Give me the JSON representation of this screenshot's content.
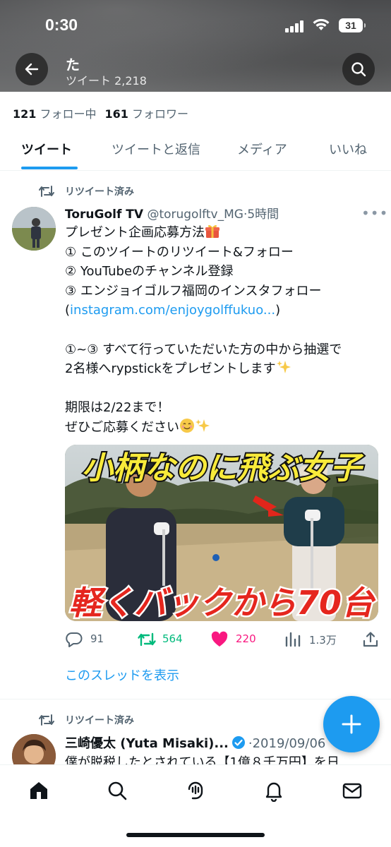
{
  "status_bar": {
    "time": "0:30",
    "battery": "31"
  },
  "header": {
    "title": "た",
    "tweet_count_label": "ツイート 2,218"
  },
  "follow": {
    "following_count": "121",
    "following_label": "フォロー中",
    "followers_count": "161",
    "followers_label": "フォロワー"
  },
  "tabs": [
    {
      "label": "ツイート",
      "active": true
    },
    {
      "label": "ツイートと返信"
    },
    {
      "label": "メディア"
    },
    {
      "label": "いいね"
    }
  ],
  "tweet1": {
    "retweet_label": "リツイート済み",
    "name": "ToruGolf TV",
    "handle": "@torugolftv_MG",
    "separator": "·",
    "time": "5時間",
    "lines": {
      "l1": "プレゼント企画応募方法",
      "l2": "① このツイートのリツイート&フォロー",
      "l3": "② YouTubeのチャンネル登録",
      "l4": "③ エンジョイゴルフ福岡のインスタフォロー",
      "l5_open": "(",
      "l5_link": "instagram.com/enjoygolffukuo...",
      "l5_close": ")",
      "l6": "①~③ すべて行っていただいた方の中から抽選で",
      "l7": "2名様へrypstickをプレゼントします",
      "l8": "期限は2/22まで！",
      "l9": "ぜひご応募ください"
    },
    "media": {
      "top_caption": "小柄なのに飛ぶ女子",
      "bottom_caption": "軽くバックから70台"
    },
    "actions": {
      "replies": "91",
      "retweets": "564",
      "likes": "220",
      "views": "1.3万"
    },
    "thread_link": "このスレッドを表示"
  },
  "tweet2": {
    "retweet_label": "リツイート済み",
    "name": "三崎優太 (Yuta Misaki)...",
    "separator": "·",
    "date": "2019/09/06",
    "text": "僕が脱税したとされている【1億８千万円】を日"
  },
  "colors": {
    "accent": "#1d9bf0",
    "retweet_green": "#00ba7c",
    "like_pink": "#f91880",
    "secondary_text": "#536471"
  },
  "icons": {
    "back": "arrow-left-icon",
    "search": "search-icon",
    "retweet": "retweet-icon",
    "reply": "reply-icon",
    "like": "heart-icon",
    "views": "bar-chart-icon",
    "share": "share-icon",
    "compose": "plus-icon",
    "home": "home-icon",
    "explore": "search-icon",
    "spaces": "microphone-icon",
    "notifications": "bell-icon",
    "messages": "envelope-icon"
  }
}
